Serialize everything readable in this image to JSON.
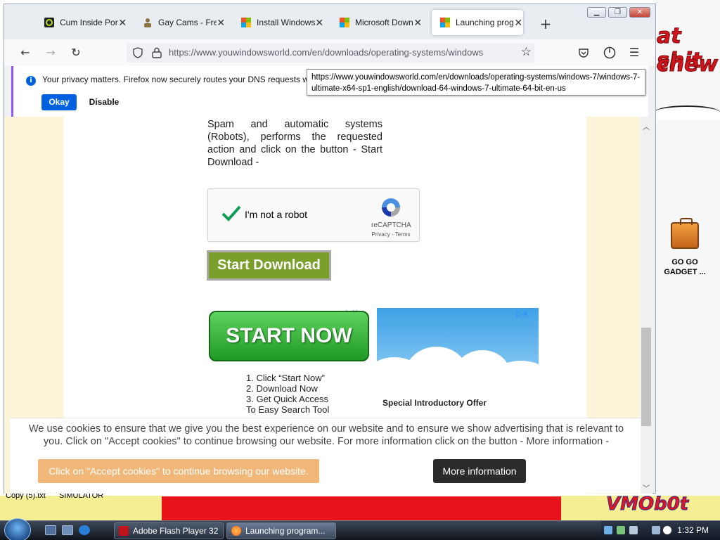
{
  "desktop": {
    "meme_line1": "at shit",
    "meme_line2": "chew",
    "watermark": "VMOb0t",
    "gadget_label": "GO GO GADGET ...",
    "copy_label": "Copy (5).txt",
    "simulator_label": "SIMULATOR"
  },
  "browser": {
    "tabs": [
      {
        "title": "Cum Inside Porn"
      },
      {
        "title": "Gay Cams - Free"
      },
      {
        "title": "Install Windows"
      },
      {
        "title": "Microsoft Down"
      },
      {
        "title": "Launching prog"
      }
    ],
    "url": "https://www.youwindowsworld.com/en/downloads/operating-systems/windows",
    "tooltip": "https://www.youwindowsworld.com/en/downloads/operating-systems/windows-7/windows-7-ultimate-x64-sp1-english/download-64-windows-7-ultimate-64-bit-en-us",
    "notification": {
      "message": "Your privacy matters. Firefox now securely routes your DNS requests whe",
      "okay": "Okay",
      "disable": "Disable"
    }
  },
  "page": {
    "instructions": "Spam and automatic systems (Robots), performs the requested action and click on the button - Start Download -",
    "captcha": {
      "label": "I'm not a robot",
      "brand": "reCAPTCHA",
      "terms": "Privacy - Terms"
    },
    "start_download": "Start Download",
    "ad1": {
      "button": "START NOW",
      "steps": [
        "1. Click “Start Now”",
        "2. Download Now",
        "3. Get Quick Access",
        "To Easy Search Tool"
      ]
    },
    "ad2": {
      "title": "Special Introductory Offer"
    },
    "cookie": {
      "text": "We use cookies to ensure that we give you the best experience on our website and to ensure we show advertising that is relevant to you. Click on \"Accept cookies\" to continue browsing our website. For more information click on the button - More information -",
      "accept": "Click on \"Accept cookies\" to continue browsing our website.",
      "more": "More information"
    }
  },
  "taskbar": {
    "buttons": [
      {
        "label": "Adobe Flash Player 32"
      },
      {
        "label": "Launching program..."
      }
    ],
    "clock": "1:32 PM"
  }
}
